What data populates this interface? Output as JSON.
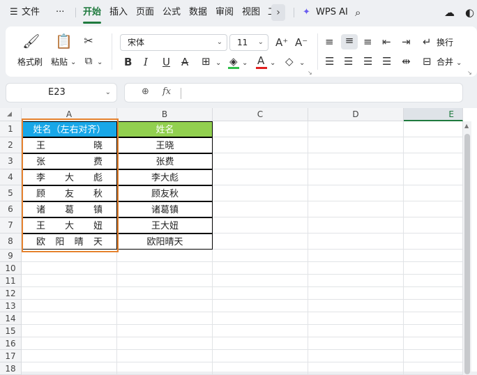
{
  "menubar": {
    "file": "文件",
    "more": "···",
    "tabs": [
      "开始",
      "插入",
      "页面",
      "公式",
      "数据",
      "审阅",
      "视图",
      "工"
    ],
    "wps_ai": "WPS AI"
  },
  "ribbon": {
    "format_painter": "格式刷",
    "paste": "粘贴",
    "font_name": "宋体",
    "font_size": "11",
    "wrap": "换行",
    "merge": "合并"
  },
  "formula_bar": {
    "cell_ref": "E23",
    "fx": "fx",
    "value": ""
  },
  "sheet": {
    "columns": [
      "A",
      "B",
      "C",
      "D",
      "E"
    ],
    "rows": [
      "1",
      "2",
      "3",
      "4",
      "5",
      "6",
      "7",
      "8",
      "9",
      "10",
      "11",
      "12",
      "13",
      "14",
      "15",
      "16",
      "17",
      "18"
    ],
    "header_a": "姓名（左右对齐）",
    "header_b": "姓名",
    "col_a": [
      [
        "王",
        "晓"
      ],
      [
        "张",
        "费"
      ],
      [
        "李",
        "大",
        "彪"
      ],
      [
        "顾",
        "友",
        "秋"
      ],
      [
        "诸",
        "葛",
        "镇"
      ],
      [
        "王",
        "大",
        "妞"
      ],
      [
        "欧",
        "阳",
        "晴",
        "天"
      ]
    ],
    "col_b": [
      "王晓",
      "张费",
      "李大彪",
      "顾友秋",
      "诸葛镇",
      "王大妞",
      "欧阳晴天"
    ]
  },
  "colors": {
    "accent": "#1f7a3e",
    "header_a_bg": "#18a7e8",
    "header_b_bg": "#92d050",
    "highlight_box": "#e6822e"
  }
}
